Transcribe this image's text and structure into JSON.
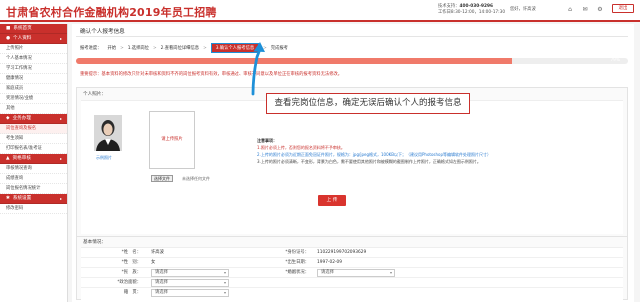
{
  "header": {
    "logo": "甘肃省农村合作金融机构2019年员工招聘",
    "support_label": "技术支持：",
    "support_phone": "400-030-9296",
    "hours": "工作日8:30-12:00，14:00-17:30",
    "user_greeting": "您好，",
    "user_name": "许高波",
    "logout_label": "退出"
  },
  "sidebar": {
    "groups": [
      {
        "title": "系统首页",
        "items": []
      },
      {
        "title": "个人资料",
        "items": [
          "上传照片",
          "个人基本情况",
          "学习工作情况",
          "健康情况",
          "家庭成员",
          "奖惩情况/业绩",
          "其他"
        ]
      },
      {
        "title": "业务办理",
        "items": [
          "岗位查询及报名",
          "考生须知",
          "打印报名表/准考证"
        ]
      },
      {
        "title": "资格审核",
        "items": [
          "审核情况查询",
          "成绩查询",
          "岗位报名情况统计"
        ]
      },
      {
        "title": "系统设置",
        "items": [
          "修改密码"
        ]
      }
    ],
    "active_item": "岗位查询及报名"
  },
  "main": {
    "page_title": "确认个人报考信息",
    "steps_label": "报考进度：",
    "steps": [
      "开始",
      "1.选择岗位",
      "2.查看岗位详细信息",
      "3.确认个人报考信息",
      "完成报考"
    ],
    "current_step": "3.确认个人报考信息",
    "step_separator": ">",
    "progress_percent": 79,
    "progress_text": "79%",
    "notice": "重要提示：基本资料的修改只针对未审核和资料不齐的岗位报考资料有效，审核通过、审核不同意以及单位正在审核的报考资料无法修改。",
    "photo_section_label": "个人照片：",
    "photo_sample_caption": "示例照片",
    "upload_box_text": "请上传照片",
    "file_button": "选择文件",
    "file_status": "未选择任何文件",
    "note_title": "注意事项：",
    "notes": [
      "1.照片必须上传，否则您的报名资料将不予审核。",
      "2.上传的照片必须为近期正面免冠证件照片，规格为：jpg/jpeg格式，100KB以下；（建议用Photoshop等编辑软件处理照片尺寸）",
      "3.上传的照片必须清晰，不变形，背景为白色，需不要使用其他照片和被模糊的截图制作上传照片，正确格式如左图示例照片。"
    ],
    "upload_button": "上 传",
    "callout": "查看完岗位信息，确定无误后确认个人的报考信息",
    "basic_section_label": "基本情况：",
    "fields": {
      "name_label": "*姓　名：",
      "name_value": "许高波",
      "id_label": "*身份证号：",
      "id_value": "110229199702093629",
      "gender_label": "*性　别：",
      "gender_value": "女",
      "birth_label": "*出生日期：",
      "birth_value": "1997-02-09",
      "ethnicity_label": "*民　族：",
      "ethnicity_value": "请选择",
      "marital_label": "*婚姻状况：",
      "marital_value": "请选择",
      "political_label": "*政治面貌：",
      "political_value": "请选择",
      "native_label": "籍　贯：",
      "native_value": "请选择"
    }
  }
}
